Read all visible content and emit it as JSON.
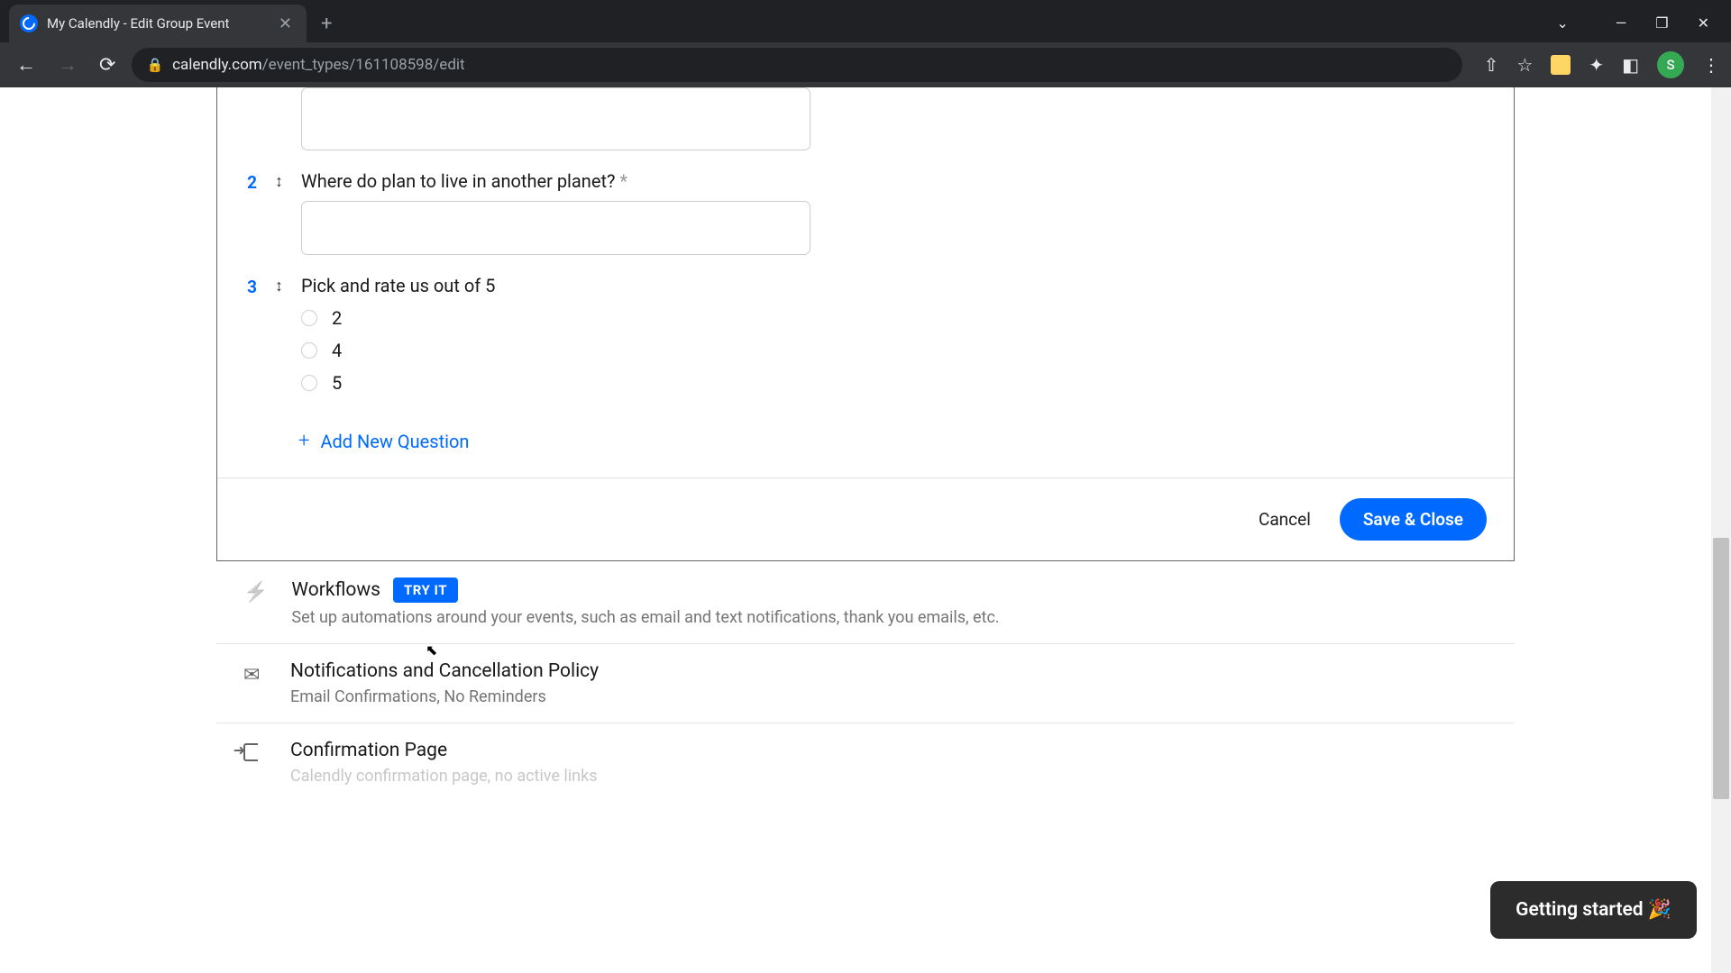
{
  "browser": {
    "tab_title": "My Calendly - Edit Group Event",
    "url_host": "calendly.com",
    "url_path": "/event_types/161108598/edit",
    "avatar_letter": "S"
  },
  "questions": [
    {
      "num": "2",
      "label": "Where do plan to live in another planet?",
      "required": true,
      "type": "text"
    },
    {
      "num": "3",
      "label": "Pick and rate us out of 5",
      "required": false,
      "type": "radio",
      "options": [
        "2",
        "4",
        "5"
      ]
    }
  ],
  "add_question_label": "Add New Question",
  "buttons": {
    "cancel": "Cancel",
    "save": "Save & Close"
  },
  "sections": {
    "workflows": {
      "title": "Workflows",
      "badge": "TRY IT",
      "sub": "Set up automations around your events, such as email and text notifications, thank you emails, etc."
    },
    "notifications": {
      "title": "Notifications and Cancellation Policy",
      "sub": "Email Confirmations, No Reminders"
    },
    "confirmation": {
      "title": "Confirmation Page",
      "sub": "Calendly confirmation page, no active links"
    }
  },
  "help_widget": "Getting started 🎉"
}
